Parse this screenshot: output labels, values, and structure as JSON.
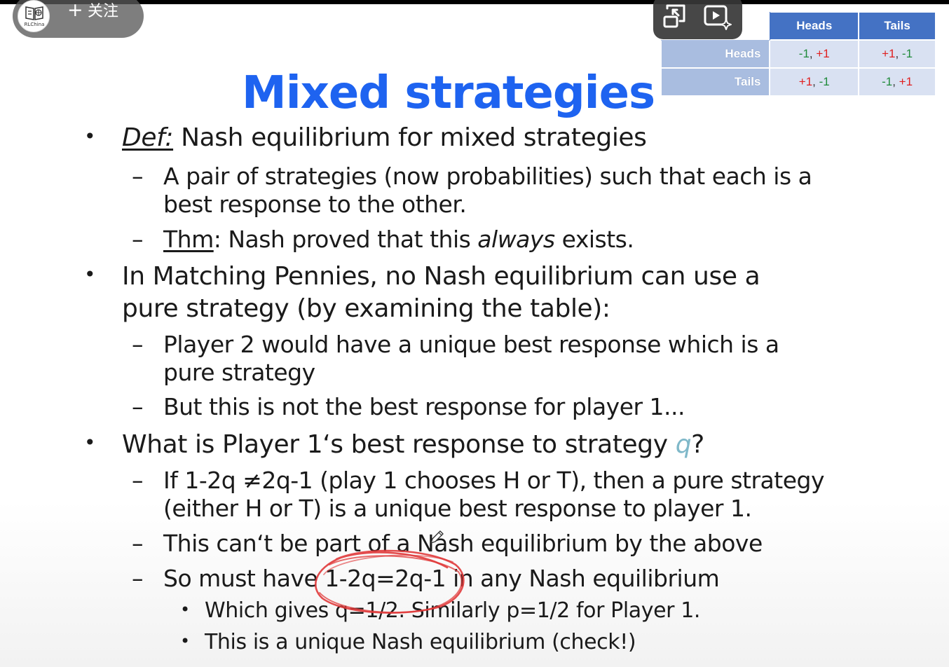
{
  "overlay": {
    "channel": {
      "logo_text": "RLChina",
      "follow_plus": "+",
      "follow_label": "关注",
      "logo_icon": "book-globe-icon"
    },
    "controls": {
      "pip_icon": "picture-in-picture-icon",
      "ai_icon": "video-sparkle-icon"
    }
  },
  "payoff_table": {
    "headers": [
      "Heads",
      "Tails"
    ],
    "rows": [
      {
        "label": "Heads",
        "cells": [
          {
            "a": "-1",
            "b": "+1"
          },
          {
            "a": "+1",
            "b": "-1"
          }
        ]
      },
      {
        "label": "Tails",
        "cells": [
          {
            "a": "+1",
            "b": "-1"
          },
          {
            "a": "-1",
            "b": "+1"
          }
        ]
      }
    ],
    "colors": {
      "header": "#4472c4",
      "row_header": "#a9bde0",
      "cell": "#d9e1f2",
      "minus_one": "#1f8a3a",
      "plus_one": "#e02020"
    }
  },
  "slide": {
    "title": "Mixed strategies",
    "title_color": "#1e63f0",
    "b1": {
      "def": "Def:",
      "text": " Nash equilibrium for mixed strategies"
    },
    "b1_s1_l1": "A pair of strategies (now probabilities) such that each is a",
    "b1_s1_l2": "best response to the other.",
    "b1_s2": {
      "thm": "Thm",
      "pre": ": Nash proved that this ",
      "always": "always",
      "post": " exists."
    },
    "b2_l1": "In Matching Pennies, no Nash equilibrium can use a",
    "b2_l2": "pure strategy (by examining the table):",
    "b2_s1_l1": "Player 2 would have a unique best response which is a",
    "b2_s1_l2": "pure strategy",
    "b2_s2": "But this is not the best response for player 1...",
    "b3": {
      "text": "What is Player 1‘s best response to strategy ",
      "q": "q",
      "end": "?"
    },
    "b3_s1_l1": "If 1-2q ≠2q-1 (play 1 chooses H or T), then a pure strategy",
    "b3_s1_l2": "(either H or T) is a unique best response to player 1.",
    "b3_s2": "This can‘t be part of a Nash equilibrium by the above",
    "b3_s3": "So must have 1-2q=2q-1 in any Nash equilibrium",
    "b3_s3_a": "Which gives q=1/2. Similarly p=1/2 for Player 1.",
    "b3_s3_b": "This is a unique Nash equilibrium (check!)",
    "bullet_char": "•",
    "dash_char": "–",
    "q_color": "#7fb8c9"
  },
  "annotation": {
    "type": "hand-drawn circle",
    "color": "#e0393a",
    "cursor_icon": "pen-icon"
  }
}
